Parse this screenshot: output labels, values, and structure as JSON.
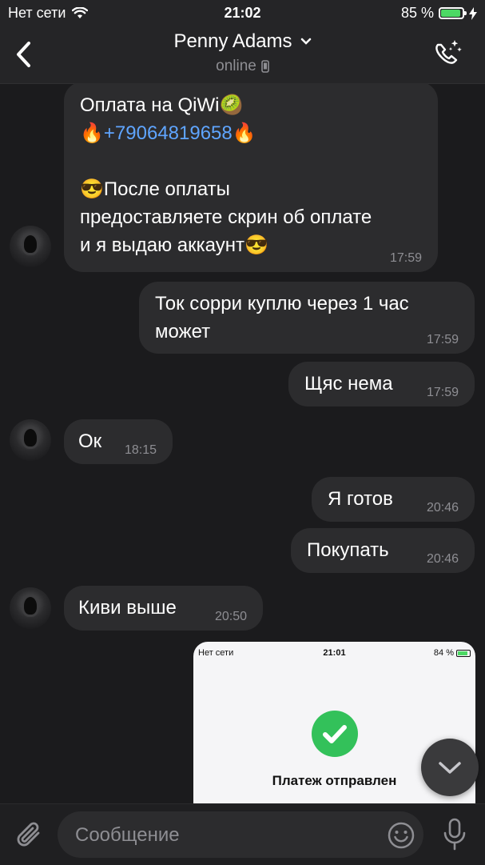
{
  "status_bar": {
    "carrier": "Нет сети",
    "time": "21:02",
    "battery": "85 %",
    "battery_level": 0.85
  },
  "header": {
    "title": "Penny Adams",
    "subtitle": "online"
  },
  "messages": [
    {
      "side": "in",
      "lines": [
        "Оплата на QiWi🥝",
        "🔥+79064819658🔥",
        "",
        "😎После оплаты",
        "предоставляете скрин об оплате",
        "и я выдаю аккаунт😎"
      ],
      "link": "+79064819658",
      "time": "17:59"
    },
    {
      "side": "out",
      "text": "Ток сорри куплю через 1 час может",
      "time": "17:59"
    },
    {
      "side": "out",
      "text": "Щяс нема",
      "time": "17:59"
    },
    {
      "side": "in",
      "text": "Ок",
      "time": "18:15"
    },
    {
      "side": "out",
      "text": "Я готов",
      "time": "20:46"
    },
    {
      "side": "out",
      "text": "Покупать",
      "time": "20:46"
    },
    {
      "side": "in",
      "text": "Киви выше",
      "time": "20:50"
    }
  ],
  "photo": {
    "carrier": "Нет сети",
    "time": "21:01",
    "battery": "84 %",
    "battery_level": 0.84,
    "title": "Платеж отправлен"
  },
  "input": {
    "placeholder": "Сообщение"
  },
  "colors": {
    "background": "#1b1b1d",
    "bubble": "#2c2c2e",
    "link": "#5fa5ff",
    "accent_green": "#33c15a"
  }
}
